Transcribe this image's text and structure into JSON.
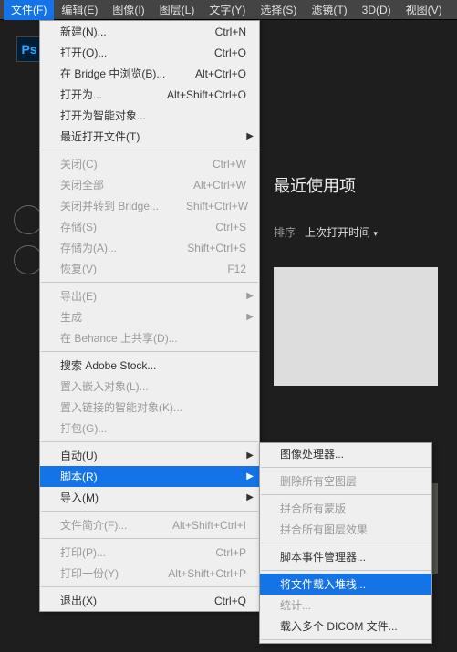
{
  "menubar": {
    "items": [
      "文件(F)",
      "编辑(E)",
      "图像(I)",
      "图层(L)",
      "文字(Y)",
      "选择(S)",
      "滤镜(T)",
      "3D(D)",
      "视图(V)"
    ]
  },
  "ps_logo": "Ps",
  "recent": {
    "title": "最近使用项",
    "sort_label": "排序",
    "sort_value": "上次打开时间"
  },
  "file_menu": [
    {
      "t": "item",
      "label": "新建(N)...",
      "sc": "Ctrl+N"
    },
    {
      "t": "item",
      "label": "打开(O)...",
      "sc": "Ctrl+O"
    },
    {
      "t": "item",
      "label": "在 Bridge 中浏览(B)...",
      "sc": "Alt+Ctrl+O"
    },
    {
      "t": "item",
      "label": "打开为...",
      "sc": "Alt+Shift+Ctrl+O"
    },
    {
      "t": "item",
      "label": "打开为智能对象..."
    },
    {
      "t": "sub",
      "label": "最近打开文件(T)"
    },
    {
      "t": "sep"
    },
    {
      "t": "item",
      "label": "关闭(C)",
      "sc": "Ctrl+W",
      "disabled": true
    },
    {
      "t": "item",
      "label": "关闭全部",
      "sc": "Alt+Ctrl+W",
      "disabled": true
    },
    {
      "t": "item",
      "label": "关闭并转到 Bridge...",
      "sc": "Shift+Ctrl+W",
      "disabled": true
    },
    {
      "t": "item",
      "label": "存储(S)",
      "sc": "Ctrl+S",
      "disabled": true
    },
    {
      "t": "item",
      "label": "存储为(A)...",
      "sc": "Shift+Ctrl+S",
      "disabled": true
    },
    {
      "t": "item",
      "label": "恢复(V)",
      "sc": "F12",
      "disabled": true
    },
    {
      "t": "sep"
    },
    {
      "t": "sub",
      "label": "导出(E)",
      "disabled": true
    },
    {
      "t": "sub",
      "label": "生成",
      "disabled": true
    },
    {
      "t": "item",
      "label": "在 Behance 上共享(D)...",
      "disabled": true
    },
    {
      "t": "sep"
    },
    {
      "t": "item",
      "label": "搜索 Adobe Stock..."
    },
    {
      "t": "item",
      "label": "置入嵌入对象(L)...",
      "disabled": true
    },
    {
      "t": "item",
      "label": "置入链接的智能对象(K)...",
      "disabled": true
    },
    {
      "t": "item",
      "label": "打包(G)...",
      "disabled": true
    },
    {
      "t": "sep"
    },
    {
      "t": "sub",
      "label": "自动(U)"
    },
    {
      "t": "sub",
      "label": "脚本(R)",
      "hover": true
    },
    {
      "t": "sub",
      "label": "导入(M)"
    },
    {
      "t": "sep"
    },
    {
      "t": "item",
      "label": "文件简介(F)...",
      "sc": "Alt+Shift+Ctrl+I",
      "disabled": true
    },
    {
      "t": "sep"
    },
    {
      "t": "item",
      "label": "打印(P)...",
      "sc": "Ctrl+P",
      "disabled": true
    },
    {
      "t": "item",
      "label": "打印一份(Y)",
      "sc": "Alt+Shift+Ctrl+P",
      "disabled": true
    },
    {
      "t": "sep"
    },
    {
      "t": "item",
      "label": "退出(X)",
      "sc": "Ctrl+Q"
    }
  ],
  "script_menu": [
    {
      "t": "item",
      "label": "图像处理器..."
    },
    {
      "t": "sep"
    },
    {
      "t": "item",
      "label": "删除所有空图层",
      "disabled": true
    },
    {
      "t": "sep"
    },
    {
      "t": "item",
      "label": "拼合所有蒙版",
      "disabled": true
    },
    {
      "t": "item",
      "label": "拼合所有图层效果",
      "disabled": true
    },
    {
      "t": "sep"
    },
    {
      "t": "item",
      "label": "脚本事件管理器..."
    },
    {
      "t": "sep"
    },
    {
      "t": "item",
      "label": "将文件载入堆栈...",
      "hover": true
    },
    {
      "t": "item",
      "label": "统计...",
      "disabled": true
    },
    {
      "t": "item",
      "label": "载入多个 DICOM 文件..."
    },
    {
      "t": "sep"
    }
  ]
}
